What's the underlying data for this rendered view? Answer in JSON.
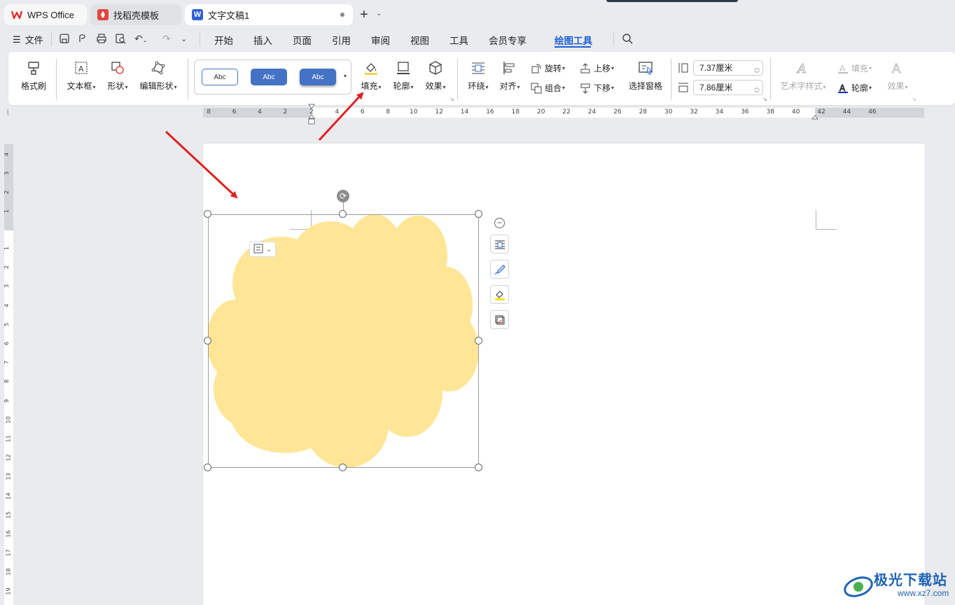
{
  "tabs": [
    {
      "label": "WPS Office",
      "icon": "wps-logo-icon"
    },
    {
      "label": "找稻壳模板",
      "icon": "docer-icon"
    },
    {
      "label": "文字文稿1",
      "icon": "writer-icon"
    }
  ],
  "menu": {
    "file": "文件",
    "items": [
      "开始",
      "插入",
      "页面",
      "引用",
      "审阅",
      "视图",
      "工具",
      "会员专享",
      "绘图工具"
    ],
    "active": "绘图工具"
  },
  "ribbon": {
    "format_painter": "格式刷",
    "text_box": "文本框",
    "shape": "形状",
    "edit_shape": "编辑形状",
    "style_samples": [
      "Abc",
      "Abc",
      "Abc"
    ],
    "fill": "填充",
    "outline": "轮廓",
    "effect": "效果",
    "wrap": "环绕",
    "align": "对齐",
    "rotate": "旋转",
    "group": "组合",
    "bring_forward": "上移",
    "send_backward": "下移",
    "selection_pane": "选择窗格",
    "height_value": "7.37厘米",
    "width_value": "7.86厘米",
    "art_text_style": "艺术字样式",
    "text_fill": "填充",
    "text_outline": "轮廓",
    "text_effect": "效果"
  },
  "ruler": {
    "h_labels": [
      "8",
      "6",
      "4",
      "2",
      "2",
      "4",
      "6",
      "8",
      "10",
      "12",
      "14",
      "16",
      "18",
      "20",
      "22",
      "24",
      "26",
      "28",
      "30",
      "32",
      "34",
      "36",
      "38",
      "40",
      "42",
      "44",
      "46"
    ],
    "v_labels_top": [
      "4",
      "3",
      "2",
      "1"
    ],
    "v_labels": [
      "1",
      "2",
      "3",
      "4",
      "5",
      "6",
      "7",
      "8",
      "9",
      "10",
      "11",
      "12",
      "13",
      "14",
      "15",
      "16",
      "17",
      "18",
      "19"
    ]
  },
  "colors": {
    "shape_fill": "#ffe697",
    "accent": "#1f5fd4",
    "arrow": "#e02020",
    "style_blue": "#4472c4"
  },
  "watermark": {
    "title": "极光下载站",
    "url": "www.xz7.com"
  }
}
